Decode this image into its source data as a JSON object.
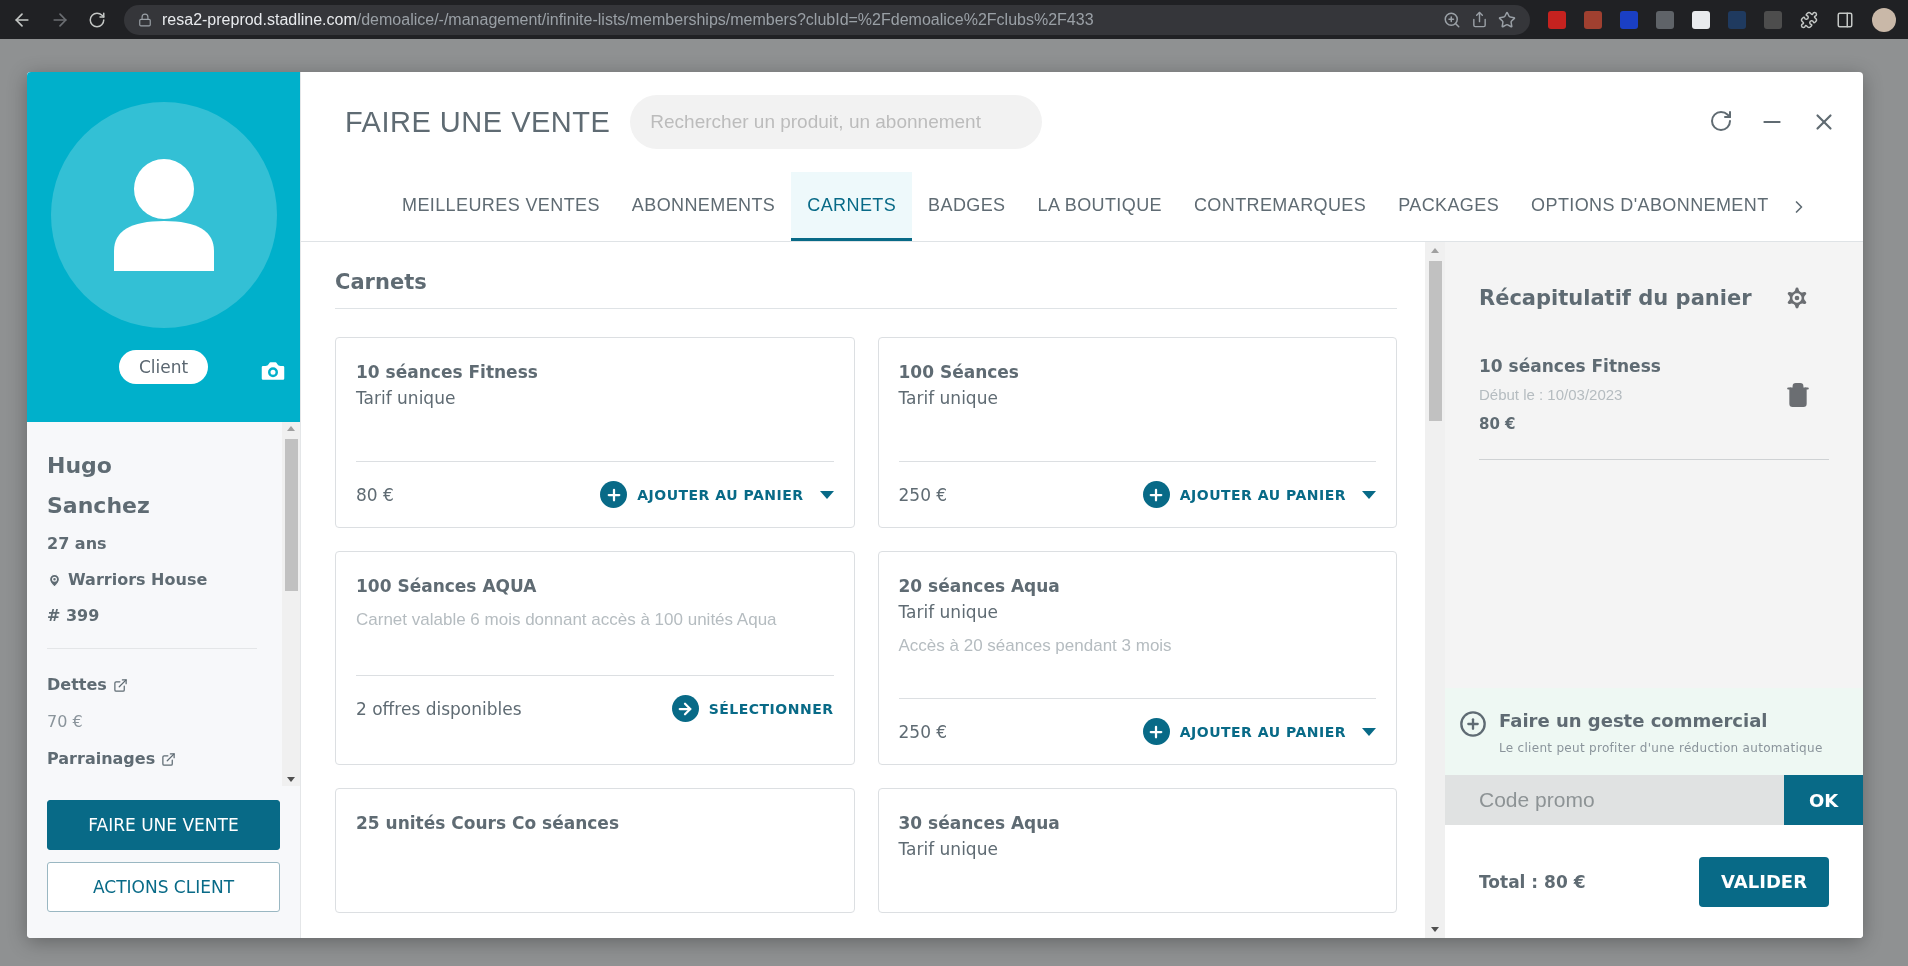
{
  "browser": {
    "url_host": "resa2-preprod.stadline.com",
    "url_path": "/demoalice/-/management/infinite-lists/memberships/members?clubId=%2Fdemoalice%2Fclubs%2F433"
  },
  "client": {
    "badge": "Client",
    "first_name": "Hugo",
    "last_name": "Sanchez",
    "age": "27 ans",
    "location": "Warriors House",
    "number": "# 399",
    "debts_label": "Dettes",
    "debts_value": "70 €",
    "sponsorship_label": "Parrainages"
  },
  "client_buttons": [
    {
      "kind": "primary",
      "label": "FAIRE UNE VENTE"
    },
    {
      "kind": "outline",
      "label": "ACTIONS CLIENT"
    }
  ],
  "sale": {
    "title": "FAIRE UNE VENTE",
    "search_placeholder": "Rechercher un produit, un abonnement",
    "tabs": [
      {
        "label": "MEILLEURES VENTES",
        "selected": false
      },
      {
        "label": "ABONNEMENTS",
        "selected": false
      },
      {
        "label": "CARNETS",
        "selected": true
      },
      {
        "label": "BADGES",
        "selected": false
      },
      {
        "label": "LA BOUTIQUE",
        "selected": false
      },
      {
        "label": "CONTREMARQUES",
        "selected": false
      },
      {
        "label": "PACKAGES",
        "selected": false
      },
      {
        "label": "OPTIONS D'ABONNEMENT",
        "selected": false
      }
    ],
    "section_title": "Carnets",
    "products": [
      {
        "name": "10 séances Fitness",
        "subtitle": "Tarif unique",
        "footer": "80 €",
        "action": {
          "kind": "add",
          "label": "AJOUTER AU PANIER"
        }
      },
      {
        "name": "100 Séances",
        "subtitle": "Tarif unique",
        "footer": "250 €",
        "action": {
          "kind": "add",
          "label": "AJOUTER AU PANIER"
        }
      },
      {
        "name": "100 Séances AQUA",
        "description": "Carnet valable 6 mois donnant accès à 100 unités Aqua",
        "footer": "2 offres disponibles",
        "action": {
          "kind": "select",
          "label": "SÉLECTIONNER"
        }
      },
      {
        "name": "20 séances Aqua",
        "subtitle": "Tarif unique",
        "description": "Accès à 20 séances pendant 3 mois",
        "footer": "250 €",
        "action": {
          "kind": "add",
          "label": "AJOUTER AU PANIER"
        }
      },
      {
        "name": "25 unités Cours Co séances"
      },
      {
        "name": "30 séances Aqua",
        "subtitle": "Tarif unique"
      }
    ]
  },
  "cart": {
    "title": "Récapitulatif du panier",
    "items": [
      {
        "name": "10 séances Fitness",
        "start": "Début le : 10/03/2023",
        "price": "80 €"
      }
    ],
    "gesture": {
      "title": "Faire un geste commercial",
      "hint": "Le client peut profiter d'une réduction automatique"
    },
    "promo": {
      "placeholder": "Code promo",
      "button": "OK"
    },
    "total": "Total : 80 €",
    "validate": "VALIDER"
  }
}
